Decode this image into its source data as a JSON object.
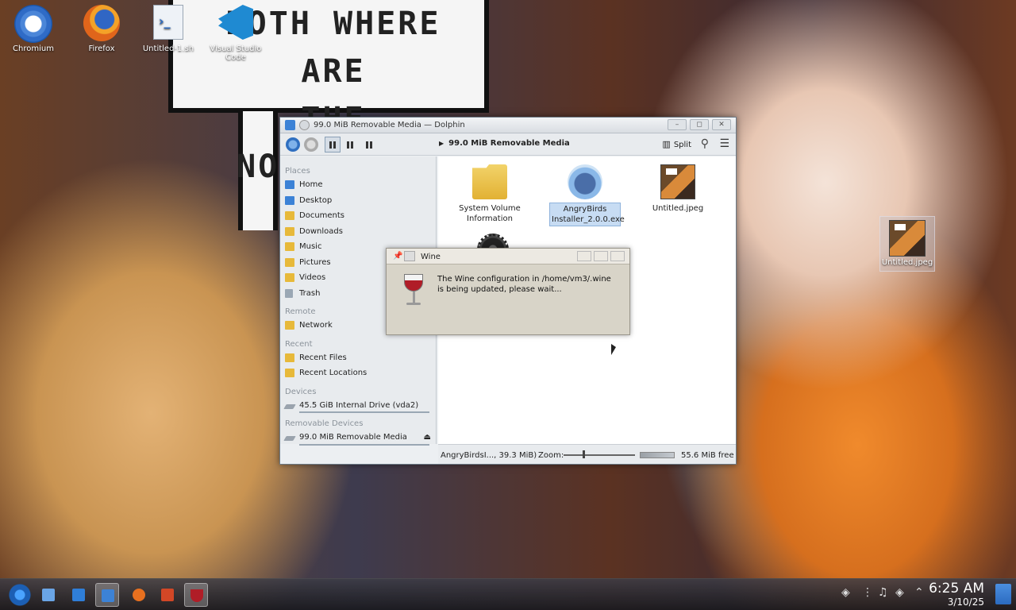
{
  "desktop": {
    "bubble_text": [
      "BOTH WHERE ARE",
      "THE NOSTRILS."
    ],
    "icons": [
      {
        "label": "Chromium"
      },
      {
        "label": "Firefox"
      },
      {
        "label": "Untitled-1.sh"
      },
      {
        "label": "Visual Studio Code"
      }
    ],
    "jpeg_icon_label": "Untitled.jpeg"
  },
  "dolphin": {
    "title": "99.0 MiB Removable Media — Dolphin",
    "breadcrumb": "99.0 MiB Removable Media",
    "split_label": "Split",
    "sidebar": {
      "places_header": "Places",
      "places": [
        "Home",
        "Desktop",
        "Documents",
        "Downloads",
        "Music",
        "Pictures",
        "Videos",
        "Trash"
      ],
      "remote_header": "Remote",
      "remote": [
        "Network"
      ],
      "recent_header": "Recent",
      "recent": [
        "Recent Files",
        "Recent Locations"
      ],
      "devices_header": "Devices",
      "devices": [
        "45.5 GiB Internal Drive (vda2)"
      ],
      "removable_header": "Removable Devices",
      "removable": [
        "99.0 MiB Removable Media"
      ]
    },
    "files": [
      {
        "name": "System Volume Information"
      },
      {
        "name": "AngryBirds Installer_2.0.0.exe"
      },
      {
        "name": "Untitled.jpeg"
      }
    ],
    "status": {
      "text": "AngryBirdsI..., 39.3 MiB)",
      "zoom_label": "Zoom:",
      "zoom_level": 0.3,
      "free_text": "55.6 MiB free"
    }
  },
  "wine_dialog": {
    "title": "Wine",
    "message": "The Wine configuration in /home/vm3/.wine is being updated, please wait..."
  },
  "taskbar": {
    "time": "6:25 AM",
    "date": "3/10/25"
  }
}
